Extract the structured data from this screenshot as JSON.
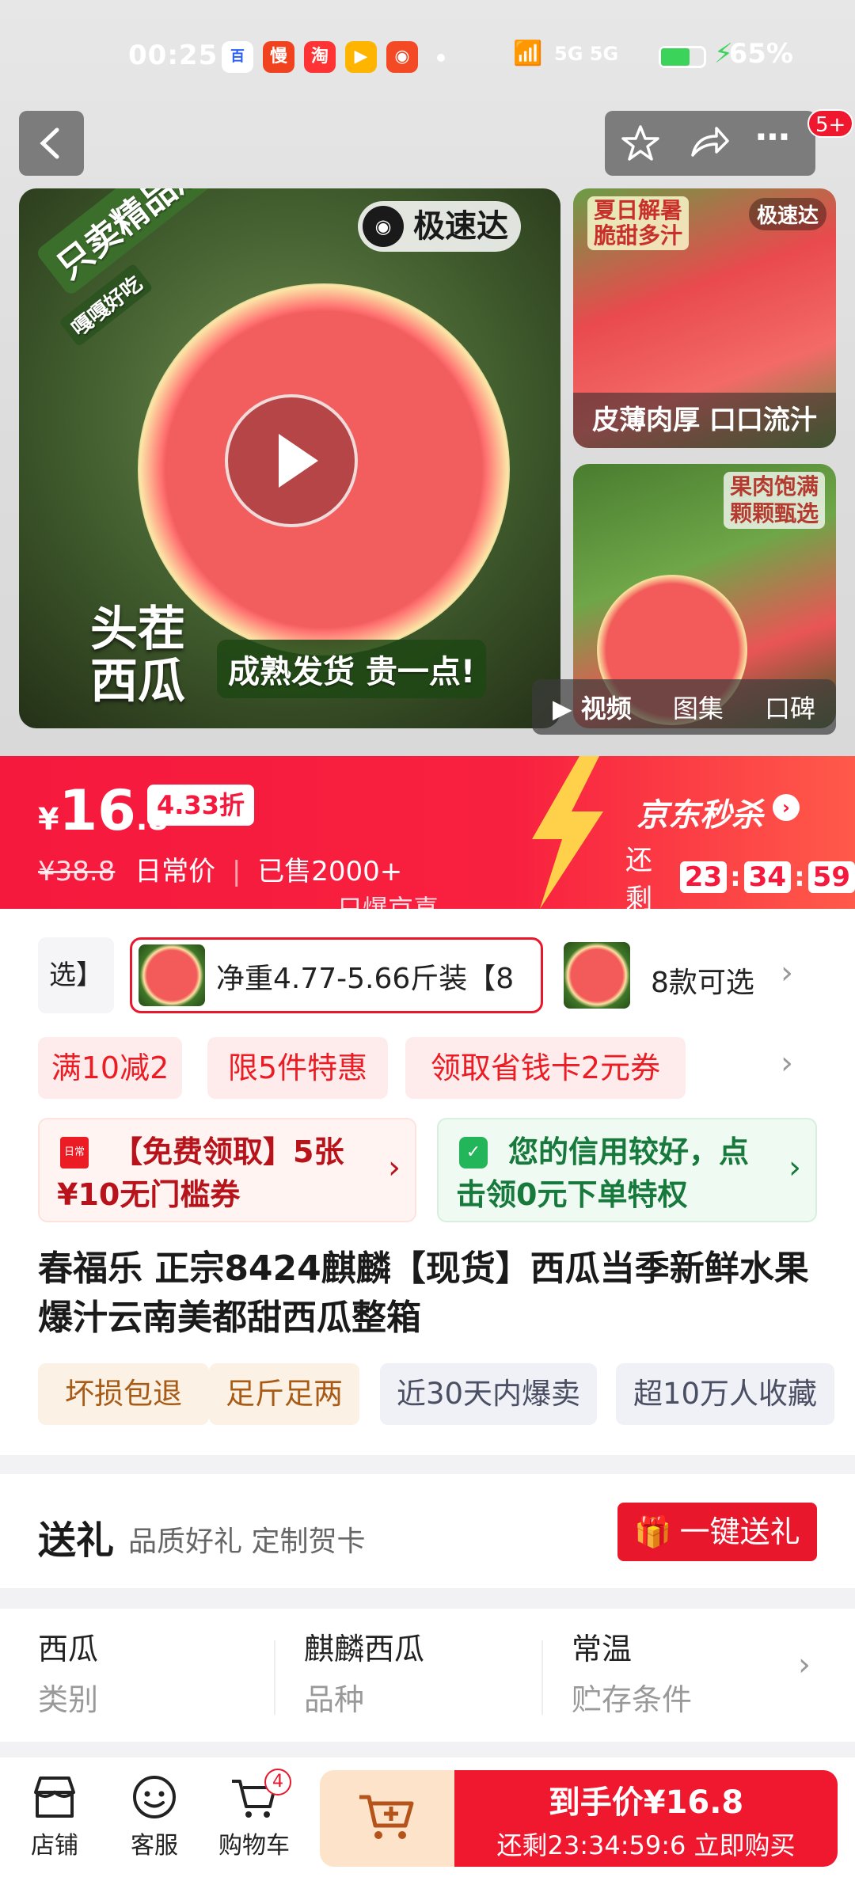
{
  "status_bar": {
    "time": "00:25",
    "apps": [
      "百度",
      "慢",
      "淘",
      "视",
      "头"
    ],
    "signal": "5G 5G",
    "battery": "65%"
  },
  "header": {
    "badge": "5+"
  },
  "media": {
    "main_tag_top": "只卖精品瓜",
    "main_tag_sub": "嘎嘎好吃",
    "brand_logo": "极速达",
    "main_title_left": "头茬\n西瓜",
    "main_title_right": "成熟发货 贵一点!",
    "side1_top": "夏日解暑\n脆甜多汁",
    "side1_brand": "极速达",
    "side1_caption": "皮薄肉厚 口口流汁",
    "side2_top": "果肉饱满\n颗颗甄选",
    "tabs": [
      "视频",
      "图集",
      "口碑"
    ]
  },
  "price_banner": {
    "currency": "¥",
    "price_int": "16",
    "price_dec": ".8",
    "discount": "4.33折",
    "original_price": "¥38.8",
    "original_label": "日常价",
    "sold": "已售2000+",
    "promo_brand": "京东秒杀",
    "remain_label": "还剩",
    "countdown": [
      "23",
      "34",
      "59"
    ],
    "slogan": "只爆京喜"
  },
  "sku": {
    "prev_partial": "选】",
    "selected": "净重4.77-5.66斤装【8",
    "more": "8款可选"
  },
  "promos": [
    "满10减2",
    "限5件特惠",
    "领取省钱卡2元券"
  ],
  "coupons": [
    {
      "badge": "日常",
      "text": "【免费领取】5张¥10无门槛券"
    },
    {
      "text": "您的信用较好，点击领0元下单特权"
    }
  ],
  "product": {
    "title": "春福乐 正宗8424麒麟【现货】西瓜当季新鲜水果爆汁云南美都甜西瓜整箱",
    "tags": [
      {
        "label": "坏损包退",
        "color": "#a85b16",
        "bg": "#fbf1e4"
      },
      {
        "label": "足斤足两",
        "color": "#a85b16",
        "bg": "#fbf1e4"
      },
      {
        "label": "近30天内爆卖",
        "color": "#4a4f63",
        "bg": "#f0f1f6"
      },
      {
        "label": "超10万人收藏",
        "color": "#4a4f63",
        "bg": "#f0f1f6"
      }
    ]
  },
  "gift": {
    "title": "送礼",
    "desc": "品质好礼 定制贺卡",
    "button": "一键送礼"
  },
  "specs": [
    {
      "value": "西瓜",
      "label": "类别"
    },
    {
      "value": "麒麟西瓜",
      "label": "品种"
    },
    {
      "value": "常温",
      "label": "贮存条件"
    }
  ],
  "bottom_bar": {
    "shop": "店铺",
    "service": "客服",
    "cart": "购物车",
    "cart_count": "4",
    "buy_price": "到手价¥16.8",
    "buy_sub": "还剩23:34:59:6 立即购买"
  },
  "colors": {
    "accent": "#f5193d",
    "brand_red": "#e8172b"
  }
}
